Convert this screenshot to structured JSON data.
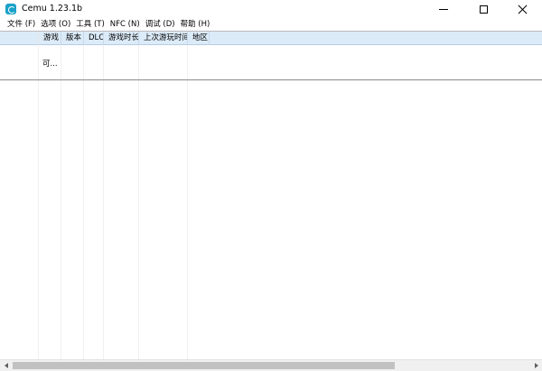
{
  "window": {
    "title": "Cemu 1.23.1b",
    "icon": "cemu-logo-icon",
    "controls": [
      "minimize-icon",
      "maximize-icon",
      "close-icon"
    ]
  },
  "menu": [
    {
      "label": "文件 (F)"
    },
    {
      "label": "选项 (O)"
    },
    {
      "label": "工具 (T)"
    },
    {
      "label": "NFC (N)"
    },
    {
      "label": "调试 (D)"
    },
    {
      "label": "帮助 (H)"
    }
  ],
  "table": {
    "columns": [
      {
        "label": ""
      },
      {
        "label": "游戏"
      },
      {
        "label": "版本"
      },
      {
        "label": "DLC"
      },
      {
        "label": "游戏时长"
      },
      {
        "label": "上次游玩时间"
      },
      {
        "label": "地区"
      }
    ],
    "rows": [
      {
        "cells": [
          "",
          "可...",
          "",
          "",
          "",
          "",
          ""
        ]
      }
    ]
  },
  "colors": {
    "header_highlight": "#dcebf8",
    "app_icon": "#1ba1c9"
  }
}
